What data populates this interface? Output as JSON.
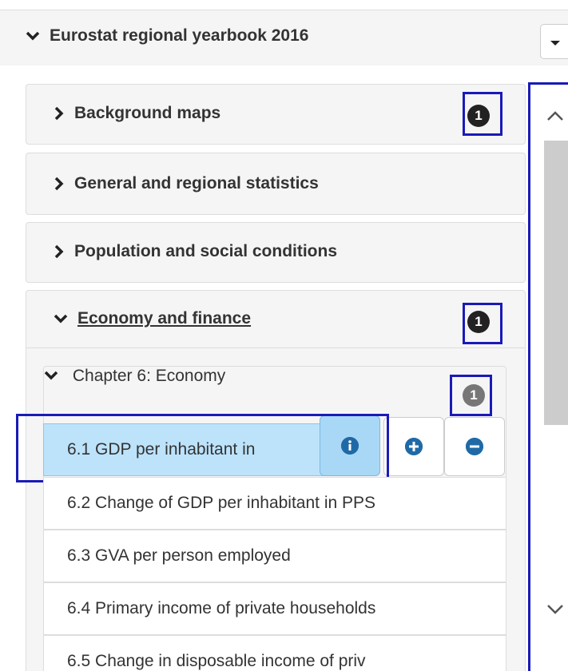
{
  "header": {
    "title": "Eurostat regional yearbook 2016",
    "chevron_icon": "chevron-down-icon",
    "dropdown_icon": "caret-down-icon"
  },
  "panels": [
    {
      "label": "Background maps",
      "expanded": false,
      "badge": "1"
    },
    {
      "label": "General and regional statistics",
      "expanded": false,
      "badge": ""
    },
    {
      "label": "Population and social conditions",
      "expanded": false,
      "badge": ""
    },
    {
      "label": "Economy and finance",
      "expanded": true,
      "badge": "1"
    }
  ],
  "chapter": {
    "label": "Chapter 6: Economy",
    "badge": "1",
    "items": [
      {
        "label": "6.1 GDP per inhabitant in",
        "selected": true
      },
      {
        "label": "6.2 Change of GDP per inhabitant in PPS",
        "selected": false
      },
      {
        "label": "6.3 GVA per person employed",
        "selected": false
      },
      {
        "label": "6.4 Primary income of private households",
        "selected": false
      },
      {
        "label": "6.5 Change in disposable income of priv",
        "selected": false
      }
    ]
  },
  "item_actions": {
    "info_icon": "info-icon",
    "add_icon": "plus-circle-icon",
    "remove_icon": "minus-circle-icon"
  },
  "scrollbar": {
    "up_icon": "chevron-up-icon",
    "down_icon": "chevron-down-icon"
  },
  "colors": {
    "accent": "#1a1ab8",
    "selected_bg": "#bde3fb",
    "icon_blue": "#1f6aa6",
    "badge_dark": "#222222",
    "badge_grey": "#777777"
  }
}
